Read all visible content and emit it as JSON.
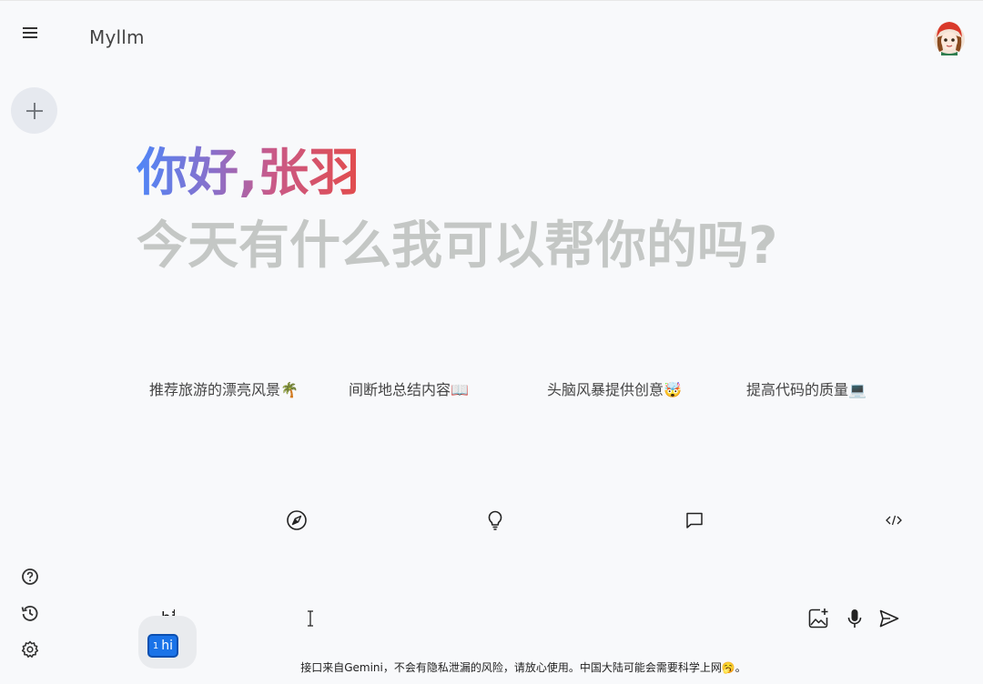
{
  "header": {
    "app_title": "Myllm"
  },
  "hero": {
    "greeting": "你好,张羽",
    "subtitle": "今天有什么我可以帮你的吗?"
  },
  "suggestions": [
    {
      "label": "推荐旅游的漂亮风景🌴",
      "icon": "compass-icon"
    },
    {
      "label": "间断地总结内容📖",
      "icon": "lightbulb-icon"
    },
    {
      "label": "头脑风暴提供创意🤯",
      "icon": "chat-bubble-icon"
    },
    {
      "label": "提高代码的质量💻",
      "icon": "code-icon"
    }
  ],
  "input": {
    "value": "hi",
    "ime_candidate_index": "1",
    "ime_candidate_text": "hi"
  },
  "footer": {
    "notice": "接口来自Gemini，不会有隐私泄漏的风险，请放心使用。中国大陆可能会需要科学上网🥱。"
  },
  "colors": {
    "background": "#f8f9fb",
    "greeting_gradient_start": "#4f86f7",
    "greeting_gradient_end": "#e24c4c",
    "subtitle": "#c4c7c5",
    "ime_highlight": "#1a73e8"
  }
}
